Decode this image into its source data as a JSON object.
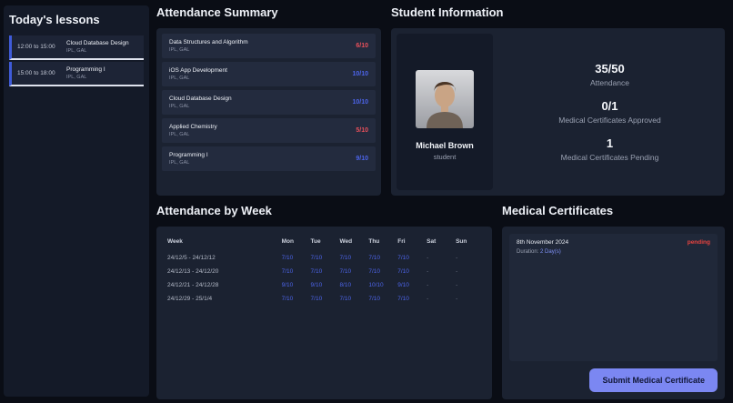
{
  "sidebar": {
    "title": "Today's lessons",
    "lessons": [
      {
        "time": "12:00 to 15:00",
        "name": "Cloud Database Design",
        "tags": "IPL, GAL"
      },
      {
        "time": "15:00 to 18:00",
        "name": "Programming I",
        "tags": "IPL, GAL"
      }
    ]
  },
  "attendance_summary": {
    "title": "Attendance Summary",
    "items": [
      {
        "name": "Data Structures and Algorithm",
        "tags": "IPL, GAL",
        "score": "6/10",
        "status": "low"
      },
      {
        "name": "iOS App Development",
        "tags": "IPL, GAL",
        "score": "10/10",
        "status": "good"
      },
      {
        "name": "Cloud Database Design",
        "tags": "IPL, GAL",
        "score": "10/10",
        "status": "good"
      },
      {
        "name": "Applied Chemistry",
        "tags": "IPL, GAL",
        "score": "5/10",
        "status": "low"
      },
      {
        "name": "Programming I",
        "tags": "IPL, GAL",
        "score": "9/10",
        "status": "good"
      }
    ]
  },
  "student_info": {
    "title": "Student Information",
    "name": "Michael Brown",
    "role": "student",
    "stats": [
      {
        "value": "35/50",
        "label": "Attendance"
      },
      {
        "value": "0/1",
        "label": "Medical Certificates Approved"
      },
      {
        "value": "1",
        "label": "Medical Certificates Pending"
      }
    ]
  },
  "attendance_by_week": {
    "title": "Attendance by Week",
    "columns": [
      "Week",
      "Mon",
      "Tue",
      "Wed",
      "Thu",
      "Fri",
      "Sat",
      "Sun"
    ],
    "rows": [
      {
        "week": "24/12/5 - 24/12/12",
        "values": [
          "7/10",
          "7/10",
          "7/10",
          "7/10",
          "7/10",
          "-",
          "-"
        ]
      },
      {
        "week": "24/12/13 - 24/12/20",
        "values": [
          "7/10",
          "7/10",
          "7/10",
          "7/10",
          "7/10",
          "-",
          "-"
        ]
      },
      {
        "week": "24/12/21 - 24/12/28",
        "values": [
          "9/10",
          "9/10",
          "8/10",
          "10/10",
          "9/10",
          "-",
          "-"
        ]
      },
      {
        "week": "24/12/29 - 25/1/4",
        "values": [
          "7/10",
          "7/10",
          "7/10",
          "7/10",
          "7/10",
          "-",
          "-"
        ]
      }
    ]
  },
  "medical_certificates": {
    "title": "Medical Certificates",
    "items": [
      {
        "date": "8th November 2024",
        "duration_label": "Duration:",
        "duration_value": "2 Day(s)",
        "status": "pending"
      }
    ],
    "submit_button": "Submit Medical Certificate"
  },
  "colors": {
    "accent_blue": "#4c64e9",
    "alert_red": "#e8505b",
    "pending_red": "#e8433f",
    "button_bg": "#7b87f2"
  }
}
